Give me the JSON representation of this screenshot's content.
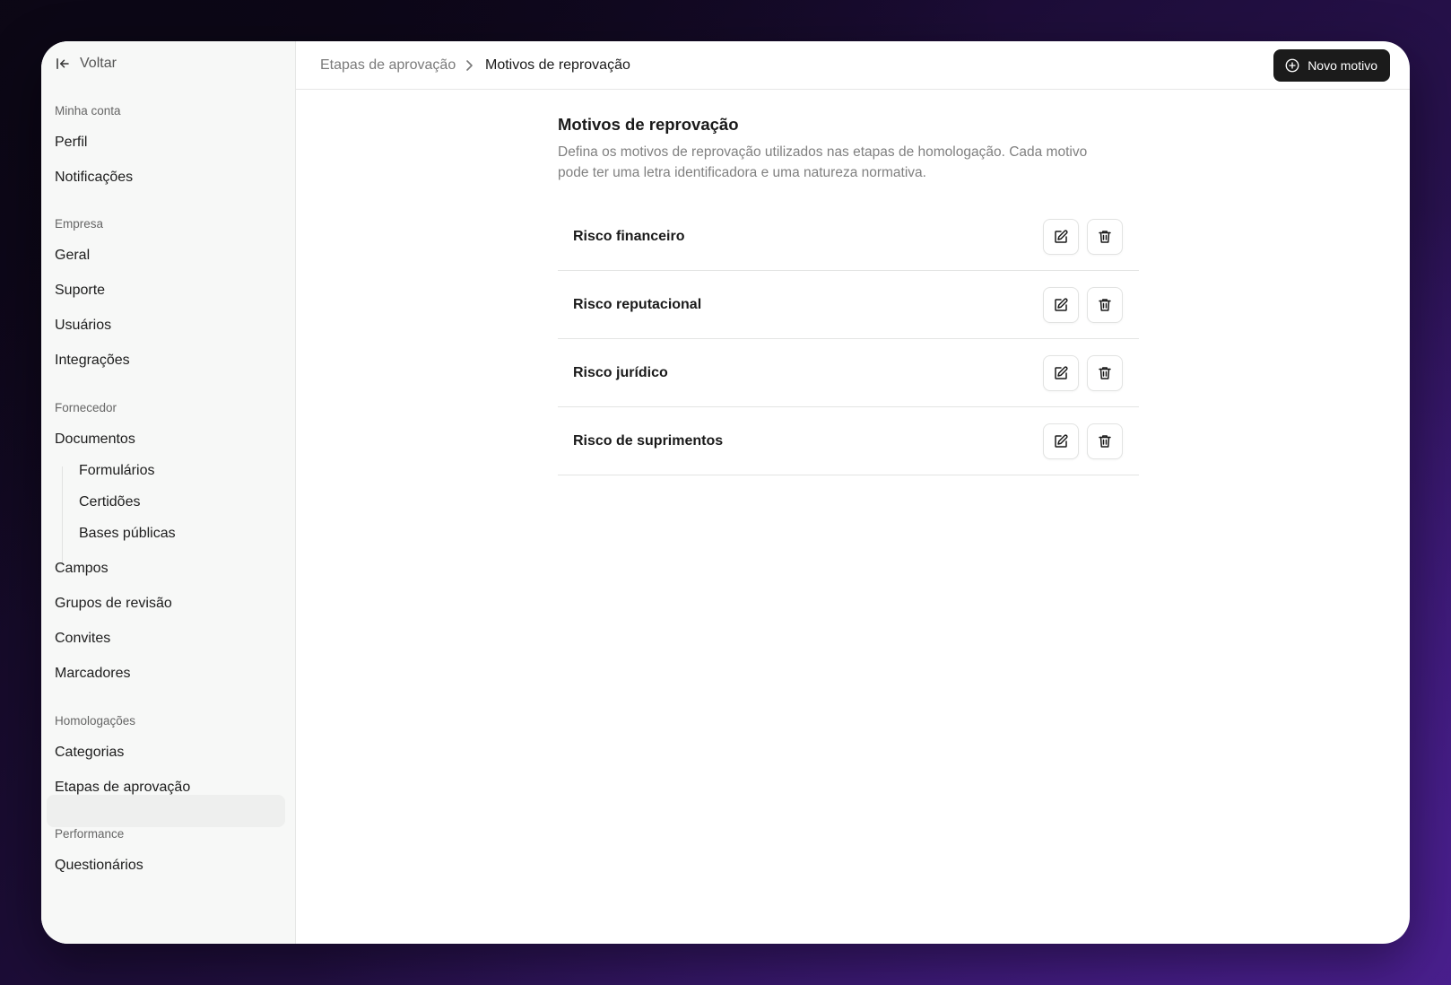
{
  "sidebar": {
    "back_label": "Voltar",
    "sections": [
      {
        "label": "Minha conta",
        "items": [
          "Perfil",
          "Notificações"
        ]
      },
      {
        "label": "Empresa",
        "items": [
          "Geral",
          "Suporte",
          "Usuários",
          "Integrações"
        ]
      },
      {
        "label": "Fornecedor",
        "items": [
          "Documentos",
          "Formulários",
          "Certidões",
          "Bases públicas",
          "Campos",
          "Grupos de revisão",
          "Convites",
          "Marcadores"
        ]
      },
      {
        "label": "Homologações",
        "items": [
          "Categorias",
          "Etapas de aprovação"
        ]
      },
      {
        "label": "Performance",
        "items": [
          "Questionários"
        ]
      }
    ],
    "active_item": "Etapas de aprovação"
  },
  "header": {
    "breadcrumb_parent": "Etapas de aprovação",
    "breadcrumb_current": "Motivos de reprovação",
    "new_button_label": "Novo motivo"
  },
  "main": {
    "title": "Motivos de reprovação",
    "description": "Defina os motivos de reprovação utilizados nas etapas de homologação. Cada motivo pode ter uma letra identificadora e uma natureza normativa.",
    "reasons": [
      {
        "name": "Risco financeiro"
      },
      {
        "name": "Risco reputacional"
      },
      {
        "name": "Risco jurídico"
      },
      {
        "name": "Risco de suprimentos"
      }
    ]
  },
  "icons": {
    "back": "arrow-left-to-line-icon",
    "separator": "chevron-right-icon",
    "new": "plus-circle-icon",
    "edit": "pencil-square-icon",
    "delete": "trash-icon"
  }
}
